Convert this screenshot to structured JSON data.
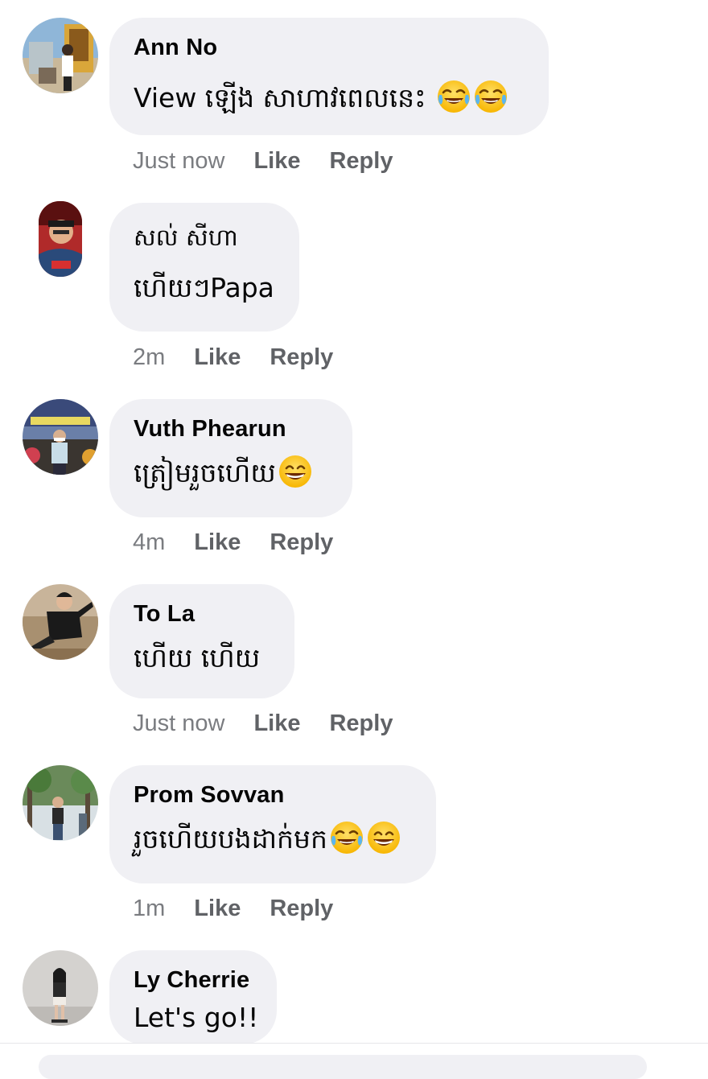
{
  "comments": [
    {
      "author": "Ann No",
      "text": "View ឡើង សាហាវពេលនេះ",
      "emojis": [
        "joy-emoji",
        "joy-emoji"
      ],
      "time": "Just now",
      "like": "Like",
      "reply": "Reply"
    },
    {
      "author": "សល់ សីហា",
      "text": "ហើយៗPapa",
      "emojis": [],
      "time": "2m",
      "like": "Like",
      "reply": "Reply"
    },
    {
      "author": "Vuth Phearun",
      "text": "ត្រៀមរួចហើយ",
      "emojis": [
        "grin-emoji"
      ],
      "time": "4m",
      "like": "Like",
      "reply": "Reply"
    },
    {
      "author": "To La",
      "text": "ហើយ ហើយ",
      "emojis": [],
      "time": "Just now",
      "like": "Like",
      "reply": "Reply"
    },
    {
      "author": "Prom Sovvan",
      "text": "រួចហើយបងដាក់មក",
      "emojis": [
        "joy-emoji",
        "grin-emoji"
      ],
      "time": "1m",
      "like": "Like",
      "reply": "Reply"
    },
    {
      "author": "Ly Cherrie",
      "text": "Let's go!!",
      "emojis": [],
      "time": "",
      "like": "",
      "reply": ""
    }
  ],
  "colors": {
    "bubble": "#f0f0f4",
    "meta": "#65676b",
    "text": "#050505"
  }
}
